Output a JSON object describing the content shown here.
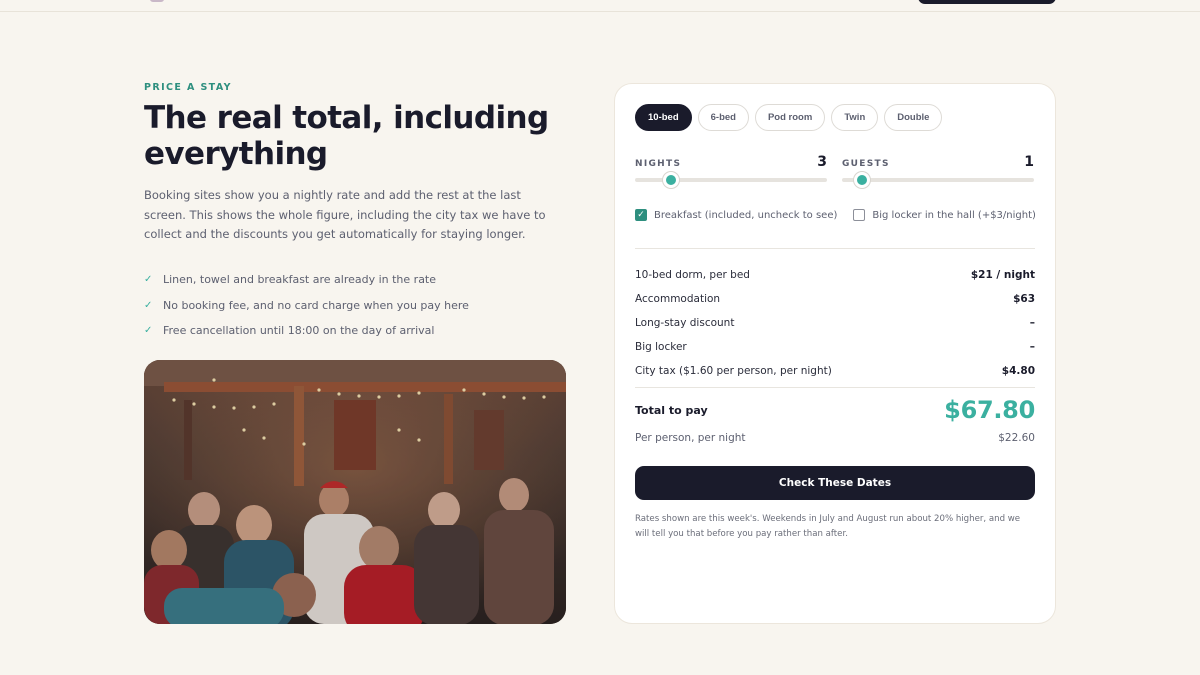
{
  "hero": {
    "eyebrow": "PRICE A STAY",
    "headline": "The real total, including everything",
    "lede": "Booking sites show you a nightly rate and add the rest at the last screen. This shows the whole figure, including the city tax we have to collect and the discounts you get automatically for staying longer.",
    "checks": [
      "Linen, towel and breakfast are already in the rate",
      "No booking fee, and no card charge when you pay here",
      "Free cancellation until 18:00 on the day of arrival"
    ],
    "check_icon": "check-icon"
  },
  "calculator": {
    "tabs": [
      {
        "label": "10-bed",
        "active": true
      },
      {
        "label": "6-bed",
        "active": false
      },
      {
        "label": "Pod room",
        "active": false
      },
      {
        "label": "Twin",
        "active": false
      },
      {
        "label": "Double",
        "active": false
      }
    ],
    "nights": {
      "label": "NIGHTS",
      "value": "3",
      "fraction": 0.1
    },
    "guests": {
      "label": "GUESTS",
      "value": "1",
      "fraction": 0.0
    },
    "options": [
      {
        "label": "Breakfast (included, uncheck to see)",
        "checked": true
      },
      {
        "label": "Big locker in the hall (+$3/night)",
        "checked": false
      }
    ],
    "lines": [
      {
        "label": "10-bed dorm, per bed",
        "amount": "$21 / night"
      },
      {
        "label": "Accommodation",
        "amount": "$63"
      },
      {
        "label": "Long-stay discount",
        "amount": "–"
      },
      {
        "label": "Big locker",
        "amount": "–"
      },
      {
        "label": "City tax ($1.60 per person, per night)",
        "amount": "$4.80"
      }
    ],
    "total_label": "Total to pay",
    "total_amount": "$67.80",
    "per_person_label": "Per person, per night",
    "per_person_amount": "$22.60",
    "button_label": "Check These Dates",
    "note": "Rates shown are this week's. Weekends in July and August run about 20% higher, and we will tell you that before you pay rather than after."
  },
  "colors": {
    "accent": "#3bb0a0",
    "dark": "#1a1b2b",
    "background": "#f8f5ef"
  }
}
